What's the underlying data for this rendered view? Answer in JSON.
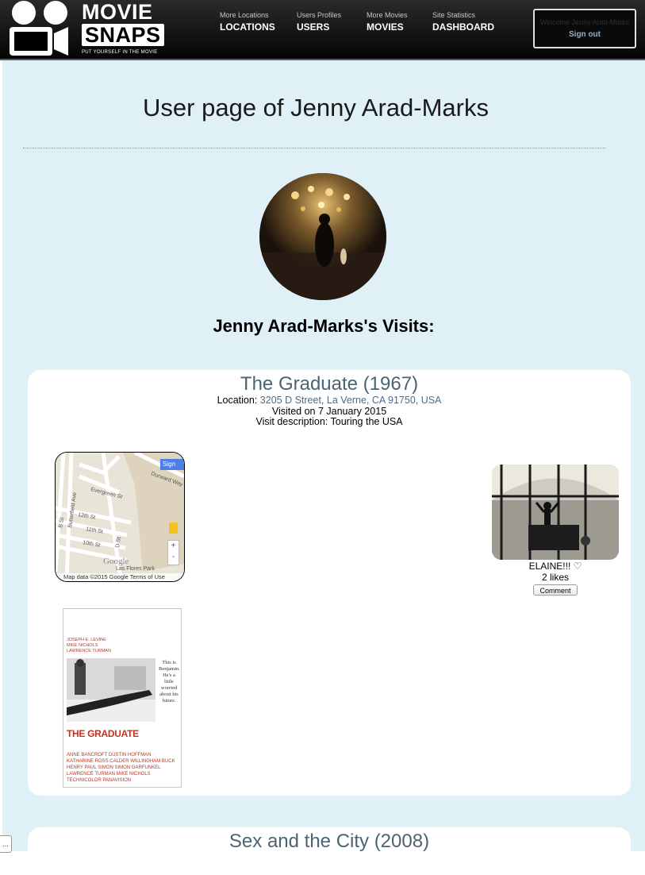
{
  "logo": {
    "line1": "MOVIE",
    "line2": "SNAPS",
    "tagline": "PUT YOURSELF IN THE MOVIE"
  },
  "nav": [
    {
      "small": "More Locations",
      "label": "LOCATIONS"
    },
    {
      "small": "Users Profiles",
      "label": "USERS"
    },
    {
      "small": "More Movies",
      "label": "MOVIES"
    },
    {
      "small": "Site Statistics",
      "label": "DASHBOARD"
    }
  ],
  "account": {
    "welcome": "Welcome Jenny Arad-Marks",
    "signout": "Sign out"
  },
  "page": {
    "title": "User page of Jenny Arad-Marks",
    "visits_heading": "Jenny Arad-Marks's Visits:"
  },
  "visits": [
    {
      "movie": "The Graduate (1967)",
      "location_label": "Location:",
      "location": "3205 D Street, La Verne, CA 91750, USA",
      "visited_on": "Visited on 7 January 2015",
      "description": "Visit description: Touring the USA",
      "map": {
        "streets": [
          "Evergreen St",
          "Durward Way",
          "12th St",
          "11th St",
          "10th St",
          "B St",
          "D St",
          "Butterfield Ave",
          "Las Flores Park"
        ],
        "attribution": "Map data ©2015 Google  Terms of Use",
        "signin": "Sign",
        "google": "Google",
        "zoom_in": "+",
        "zoom_out": "-"
      },
      "snap": {
        "caption": "ELAINE!!! ♡",
        "likes": "2 likes",
        "comment_button": "Comment"
      },
      "poster": {
        "credits": [
          "JOSEPH E. LEVINE",
          "MIKE NICHOLS",
          "LAWRENCE TURMAN"
        ],
        "tagline": "This is Benjamin. He's a little worried about his future.",
        "title": "THE GRADUATE",
        "cast": "ANNE BANCROFT  DUSTIN HOFFMAN · KATHARINE ROSS  CALDER WILLINGHAM  BUCK HENRY  PAUL SIMON  SIMON  GARFUNKEL  LAWRENCE TURMAN  MIKE NICHOLS  TECHNICOLOR  PANAVISION"
      }
    },
    {
      "movie": "Sex and the City (2008)"
    }
  ],
  "corner_tab": "..."
}
